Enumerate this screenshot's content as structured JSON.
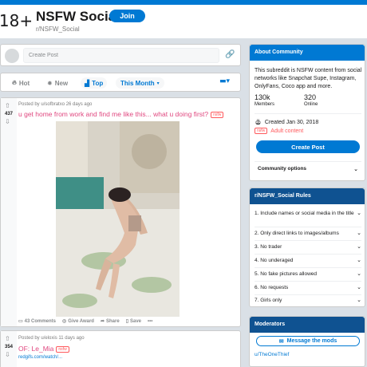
{
  "subreddit": {
    "icon_text": "18+",
    "title": "NSFW Social",
    "join_label": "Join",
    "name": "r/NSFW_Social"
  },
  "create_post": {
    "placeholder": "Create Post"
  },
  "sort": {
    "hot": "Hot",
    "new": "New",
    "top": "Top",
    "time_filter": "This Month"
  },
  "posts": [
    {
      "votes": "437",
      "meta": "Posted by u/sofbratxo 26 days ago",
      "title": "u get home from work and find me like this... what u doing first?",
      "tag": "nsfw",
      "comments": "43 Comments",
      "give_award": "Give Award",
      "share": "Share",
      "save": "Save",
      "more": "•••"
    },
    {
      "votes": "354",
      "meta": "Posted by u/eloxis 11 days ago",
      "title": "OF: Le_Mia",
      "tag": "nsfw",
      "link": "redgifs.com/watch/..."
    }
  ],
  "about": {
    "header": "About Community",
    "description": "This subreddit is NSFW content from social networks like Snapchat Supe, Instagram, OnlyFans, Coco app and more.",
    "members_value": "130k",
    "members_label": "Members",
    "online_value": "320",
    "online_label": "Online",
    "created": "Created Jan 30, 2018",
    "adult_tag": "nsfw",
    "adult_label": "Adult content",
    "create_post_button": "Create Post",
    "community_options": "Community options"
  },
  "rules": {
    "header": "r/NSFW_Social Rules",
    "items": [
      "1. Include names or social media in the title",
      "2. Only direct links to images/albums",
      "3. No trader",
      "4. No underaged",
      "5. No fake pictures allowed",
      "6. No requests",
      "7. Girls only"
    ]
  },
  "moderators": {
    "header": "Moderators",
    "message_button": "Message the mods",
    "mod_name": "u/TheOneThief"
  },
  "colors": {
    "accent": "#0079d3",
    "title_pink": "#e0477f",
    "nsfw_red": "#ff585b"
  }
}
